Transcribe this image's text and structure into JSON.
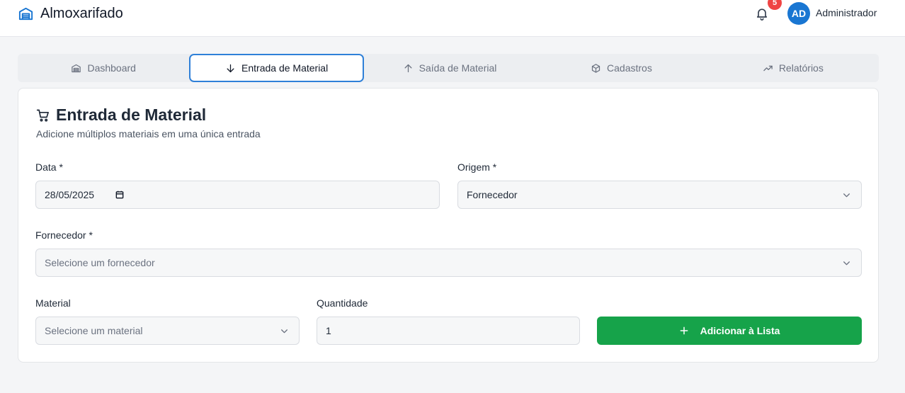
{
  "app": {
    "title": "Almoxarifado",
    "logo_icon": "warehouse-icon"
  },
  "header": {
    "notifications_count": "5",
    "avatar_initials": "AD",
    "user_name": "Administrador"
  },
  "tabs": [
    {
      "label": "Dashboard",
      "icon": "warehouse-icon",
      "active": false
    },
    {
      "label": "Entrada de Material",
      "icon": "arrow-down-icon",
      "active": true
    },
    {
      "label": "Saída de Material",
      "icon": "arrow-up-icon",
      "active": false
    },
    {
      "label": "Cadastros",
      "icon": "box-icon",
      "active": false
    },
    {
      "label": "Relatórios",
      "icon": "trending-up-icon",
      "active": false
    }
  ],
  "form": {
    "title": "Entrada de Material",
    "subtitle": "Adicione múltiplos materiais em uma única entrada",
    "data_label": "Data *",
    "data_value": "28/05/2025",
    "origem_label": "Origem *",
    "origem_value": "Fornecedor",
    "fornecedor_label": "Fornecedor *",
    "fornecedor_placeholder": "Selecione um fornecedor",
    "material_label": "Material",
    "material_placeholder": "Selecione um material",
    "quantidade_label": "Quantidade",
    "quantidade_value": "1",
    "add_button_label": "Adicionar à Lista"
  },
  "colors": {
    "accent": "#2f80d8",
    "primary_button": "#16a34a",
    "badge": "#ef4444",
    "avatar": "#1976d2"
  }
}
